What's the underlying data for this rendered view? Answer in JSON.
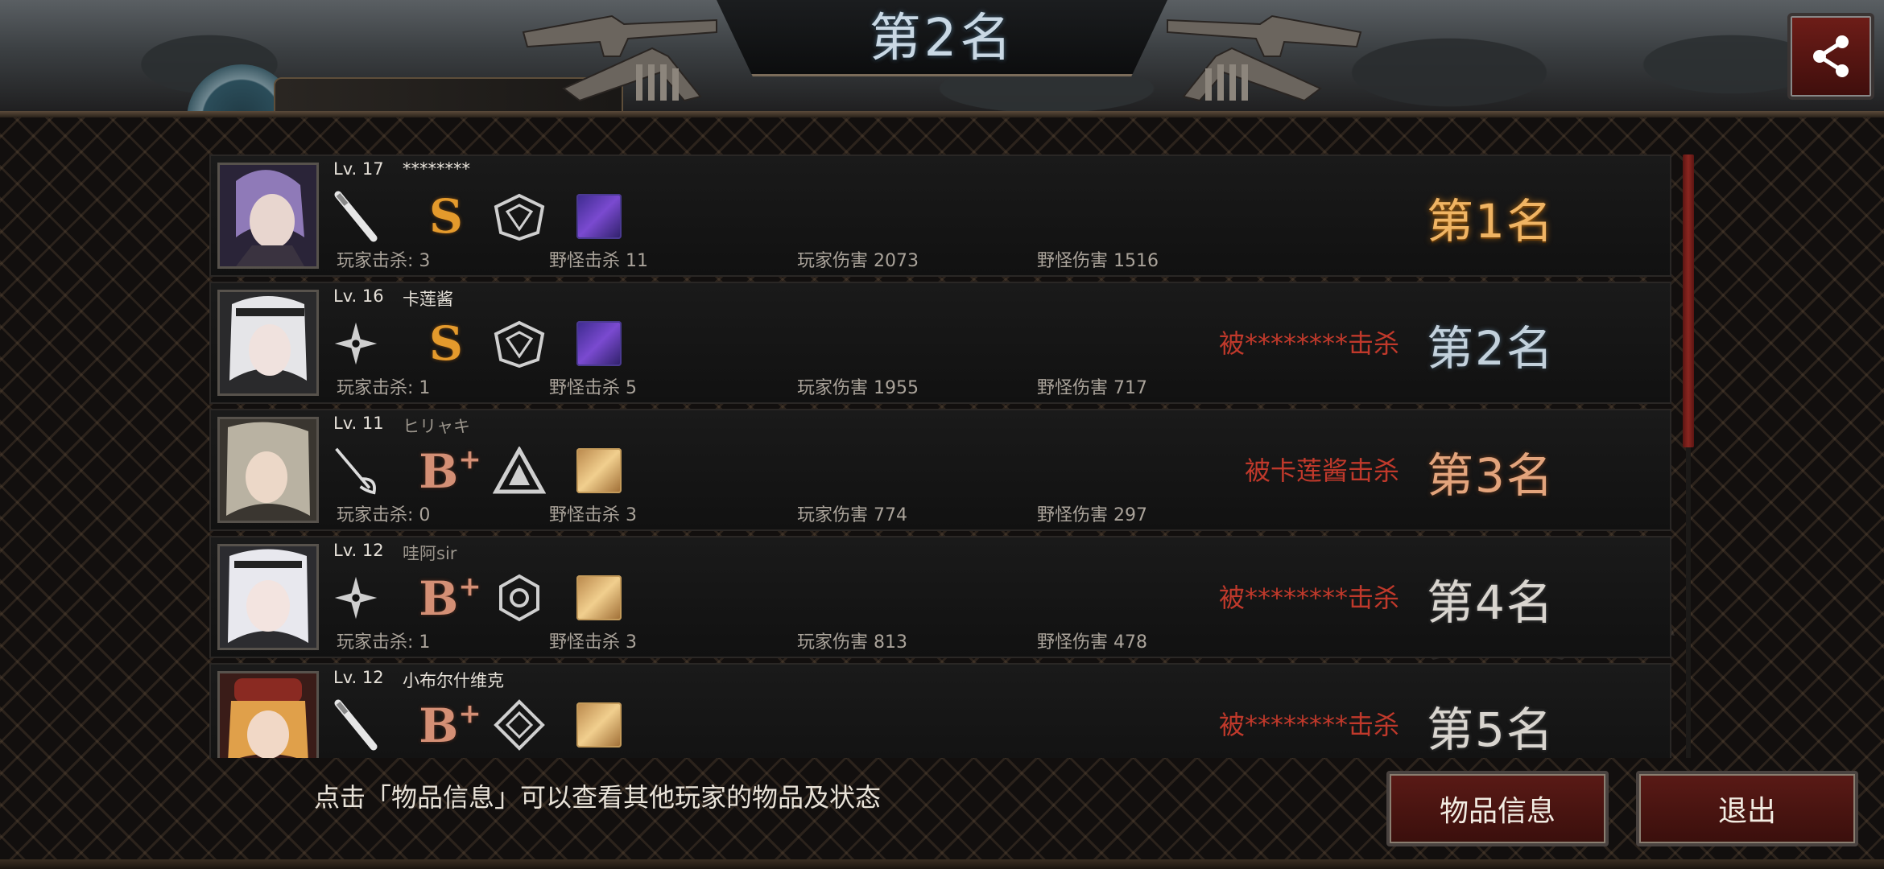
{
  "header": {
    "title": "第2名",
    "player_name_partial": "卡莲酱"
  },
  "share_button": {
    "icon": "share-icon"
  },
  "players": [
    {
      "level": "Lv. 17",
      "name": "********",
      "weapon": "baseball-bat-icon",
      "grade": "S",
      "grade_plus": "",
      "armor": "hexagon-shield-icon",
      "item": "purple-item-icon",
      "player_kills": "玩家击杀: 3",
      "monster_kills": "野怪击杀 11",
      "player_damage": "玩家伤害 2073",
      "monster_damage": "野怪伤害 1516",
      "killed_by": "",
      "rank": "第1名"
    },
    {
      "level": "Lv. 16",
      "name": "卡莲酱",
      "weapon": "shuriken-icon",
      "grade": "S",
      "grade_plus": "",
      "armor": "hexagon-shield-icon",
      "item": "purple-item-icon",
      "player_kills": "玩家击杀: 1",
      "monster_kills": "野怪击杀 5",
      "player_damage": "玩家伤害 1955",
      "monster_damage": "野怪伤害 717",
      "killed_by": "被********击杀",
      "rank": "第2名"
    },
    {
      "level": "Lv. 11",
      "name": "ヒリャキ",
      "weapon": "rapier-icon",
      "grade": "B",
      "grade_plus": "+",
      "armor": "triangle-icon",
      "item": "gold-item-icon",
      "player_kills": "玩家击杀: 0",
      "monster_kills": "野怪击杀 3",
      "player_damage": "玩家伤害 774",
      "monster_damage": "野怪伤害 297",
      "killed_by": "被卡莲酱击杀",
      "rank": "第3名"
    },
    {
      "level": "Lv. 12",
      "name": "哇阿sir",
      "weapon": "shuriken-icon",
      "grade": "B",
      "grade_plus": "+",
      "armor": "hexagon-ring-icon",
      "item": "gold-item-icon",
      "player_kills": "玩家击杀: 1",
      "monster_kills": "野怪击杀 3",
      "player_damage": "玩家伤害 813",
      "monster_damage": "野怪伤害 478",
      "killed_by": "被********击杀",
      "rank": "第4名"
    },
    {
      "level": "Lv. 12",
      "name": "小布尔什维克",
      "weapon": "baseball-bat-icon",
      "grade": "B",
      "grade_plus": "+",
      "armor": "diamond-icon",
      "item": "gold-item-icon",
      "player_kills": "",
      "monster_kills": "",
      "player_damage": "",
      "monster_damage": "",
      "killed_by": "被********击杀",
      "rank": "第5名"
    }
  ],
  "footer": {
    "hint": "点击「物品信息」可以查看其他玩家的物品及状态",
    "items_button": "物品信息",
    "exit_button": "退出"
  },
  "colors": {
    "rank_first": "#f0b463",
    "rank_second": "#c3d1dc",
    "rank_third": "#e3a47c",
    "killed_text": "#c0392b",
    "button_bg": "#4a1512"
  }
}
